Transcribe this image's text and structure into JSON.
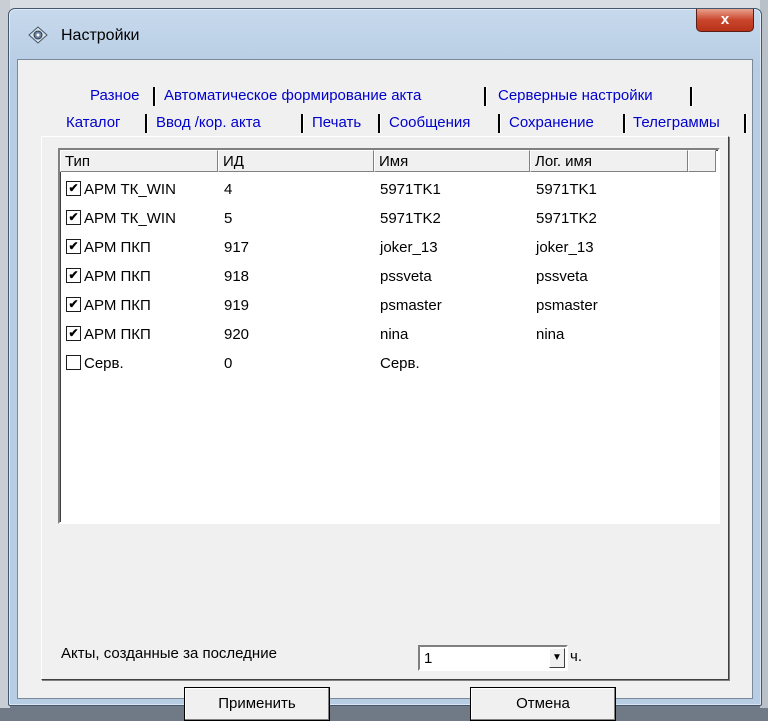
{
  "window": {
    "title": "Настройки",
    "close": "x"
  },
  "tabs": {
    "row1": [
      "Разное",
      "Автоматическое формирование акта",
      "Серверные настройки"
    ],
    "row2": [
      "Каталог",
      "Ввод /кор. акта",
      "Печать",
      "Сообщения",
      "Сохранение",
      "Телеграммы"
    ],
    "active": "Каталог"
  },
  "list": {
    "columns": [
      "Тип",
      "ИД",
      "Имя",
      "Лог. имя"
    ],
    "rows": [
      {
        "checked": true,
        "type": "АРМ ТК_WIN",
        "id": "4",
        "name": "5971TK1",
        "log": "5971TK1"
      },
      {
        "checked": true,
        "type": "АРМ ТК_WIN",
        "id": "5",
        "name": "5971TK2",
        "log": "5971TK2"
      },
      {
        "checked": true,
        "type": "АРМ ПКП",
        "id": "917",
        "name": "joker_13",
        "log": "joker_13"
      },
      {
        "checked": true,
        "type": "АРМ ПКП",
        "id": "918",
        "name": "pssveta",
        "log": "pssveta"
      },
      {
        "checked": true,
        "type": "АРМ ПКП",
        "id": "919",
        "name": "psmaster",
        "log": "psmaster"
      },
      {
        "checked": true,
        "type": "АРМ ПКП",
        "id": "920",
        "name": "nina",
        "log": "nina"
      },
      {
        "checked": false,
        "type": "Серв.",
        "id": "0",
        "name": "Серв.",
        "log": ""
      }
    ]
  },
  "acts": {
    "label": "Акты, созданные за последние",
    "value": "1",
    "unit": "ч."
  },
  "buttons": {
    "apply": "Применить",
    "cancel": "Отмена"
  }
}
